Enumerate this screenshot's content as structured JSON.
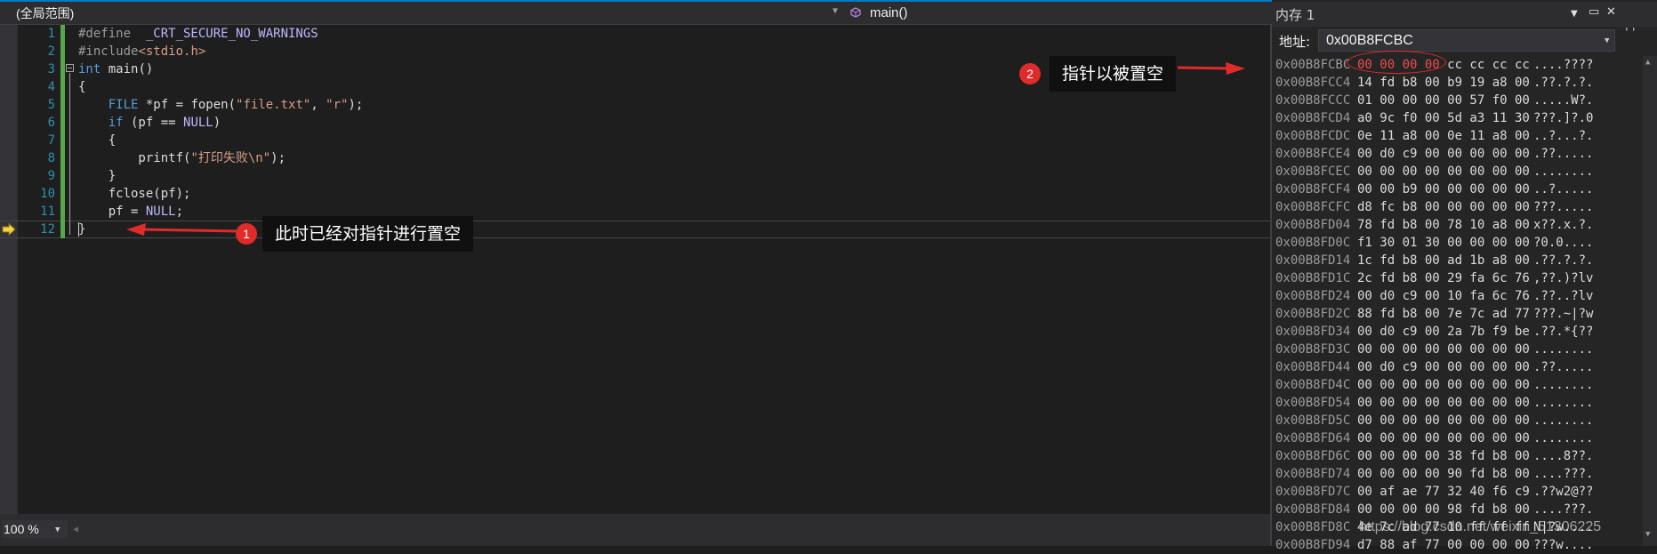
{
  "editor": {
    "scope": "(全局范围)",
    "function": "main()",
    "line_numbers": [
      "1",
      "2",
      "3",
      "4",
      "5",
      "6",
      "7",
      "8",
      "9",
      "10",
      "11",
      "12"
    ],
    "code": {
      "l1_a": "#define  ",
      "l1_b": "_CRT_SECURE_NO_WARNINGS",
      "l2_a": "#include",
      "l2_b": "<stdio.h>",
      "l3_a": "int",
      "l3_b": " main()",
      "l4": "{",
      "l5_a": "    FILE",
      "l5_b": " *pf = fopen(",
      "l5_c": "\"file.txt\"",
      "l5_d": ", ",
      "l5_e": "\"r\"",
      "l5_f": ");",
      "l6_a": "    if",
      "l6_b": " (pf == ",
      "l6_c": "NULL",
      "l6_d": ")",
      "l7": "    {",
      "l8_a": "        printf(",
      "l8_b": "\"打印失败\\n\"",
      "l8_c": ");",
      "l9": "    }",
      "l10": "    fclose(pf);",
      "l11_a": "    pf = ",
      "l11_b": "NULL",
      "l11_c": ";",
      "l12": "}"
    },
    "zoom": "100 %"
  },
  "annotations": {
    "one": {
      "num": "1",
      "text": "此时已经对指针进行置空"
    },
    "two": {
      "num": "2",
      "text": "指针以被置空"
    }
  },
  "memory": {
    "title": "内存 1",
    "address_label": "地址:",
    "address_value": "0x00B8FCBC",
    "rows": [
      {
        "addr": "0x00B8FCBC",
        "changed": "00 00 00 00",
        "bytes": " cc cc cc cc",
        "ascii": "....????"
      },
      {
        "addr": "0x00B8FCC4",
        "bytes": "14 fd b8 00 b9 19 a8 00",
        "ascii": ".??.?.?."
      },
      {
        "addr": "0x00B8FCCC",
        "bytes": "01 00 00 00 00 57 f0 00",
        "ascii": ".....W?."
      },
      {
        "addr": "0x00B8FCD4",
        "bytes": "a0 9c f0 00 5d a3 11 30",
        "ascii": "???.]?.0"
      },
      {
        "addr": "0x00B8FCDC",
        "bytes": "0e 11 a8 00 0e 11 a8 00",
        "ascii": "..?...?."
      },
      {
        "addr": "0x00B8FCE4",
        "bytes": "00 d0 c9 00 00 00 00 00",
        "ascii": ".??....."
      },
      {
        "addr": "0x00B8FCEC",
        "bytes": "00 00 00 00 00 00 00 00",
        "ascii": "........"
      },
      {
        "addr": "0x00B8FCF4",
        "bytes": "00 00 b9 00 00 00 00 00",
        "ascii": "..?....."
      },
      {
        "addr": "0x00B8FCFC",
        "bytes": "d8 fc b8 00 00 00 00 00",
        "ascii": "???....."
      },
      {
        "addr": "0x00B8FD04",
        "bytes": "78 fd b8 00 78 10 a8 00",
        "ascii": "x??.x.?."
      },
      {
        "addr": "0x00B8FD0C",
        "bytes": "f1 30 01 30 00 00 00 00",
        "ascii": "?0.0...."
      },
      {
        "addr": "0x00B8FD14",
        "bytes": "1c fd b8 00 ad 1b a8 00",
        "ascii": ".??.?.?."
      },
      {
        "addr": "0x00B8FD1C",
        "bytes": "2c fd b8 00 29 fa 6c 76",
        "ascii": ",??.)?lv"
      },
      {
        "addr": "0x00B8FD24",
        "bytes": "00 d0 c9 00 10 fa 6c 76",
        "ascii": ".??..?lv"
      },
      {
        "addr": "0x00B8FD2C",
        "bytes": "88 fd b8 00 7e 7c ad 77",
        "ascii": "???.~|?w"
      },
      {
        "addr": "0x00B8FD34",
        "bytes": "00 d0 c9 00 2a 7b f9 be",
        "ascii": ".??.*{??"
      },
      {
        "addr": "0x00B8FD3C",
        "bytes": "00 00 00 00 00 00 00 00",
        "ascii": "........"
      },
      {
        "addr": "0x00B8FD44",
        "bytes": "00 d0 c9 00 00 00 00 00",
        "ascii": ".??....."
      },
      {
        "addr": "0x00B8FD4C",
        "bytes": "00 00 00 00 00 00 00 00",
        "ascii": "........"
      },
      {
        "addr": "0x00B8FD54",
        "bytes": "00 00 00 00 00 00 00 00",
        "ascii": "........"
      },
      {
        "addr": "0x00B8FD5C",
        "bytes": "00 00 00 00 00 00 00 00",
        "ascii": "........"
      },
      {
        "addr": "0x00B8FD64",
        "bytes": "00 00 00 00 00 00 00 00",
        "ascii": "........"
      },
      {
        "addr": "0x00B8FD6C",
        "bytes": "00 00 00 00 38 fd b8 00",
        "ascii": "....8??."
      },
      {
        "addr": "0x00B8FD74",
        "bytes": "00 00 00 00 90 fd b8 00",
        "ascii": "....???."
      },
      {
        "addr": "0x00B8FD7C",
        "bytes": "00 af ae 77 32 40 f6 c9",
        "ascii": ".??w2@??"
      },
      {
        "addr": "0x00B8FD84",
        "bytes": "00 00 00 00 98 fd b8 00",
        "ascii": "....???."
      },
      {
        "addr": "0x00B8FD8C",
        "bytes": "4e 7c ad 77 10 ff ff ff",
        "ascii": "N|?w...."
      },
      {
        "addr": "0x00B8FD94",
        "bytes": "d7 88 af 77 00 00 00 00",
        "ascii": "???w...."
      }
    ]
  },
  "watermark": "https://blog.csdn.net/weixin_51306225",
  "colors": {
    "accent": "#007acc",
    "annotation": "#e02b2b",
    "change_bar": "#57a64a"
  }
}
